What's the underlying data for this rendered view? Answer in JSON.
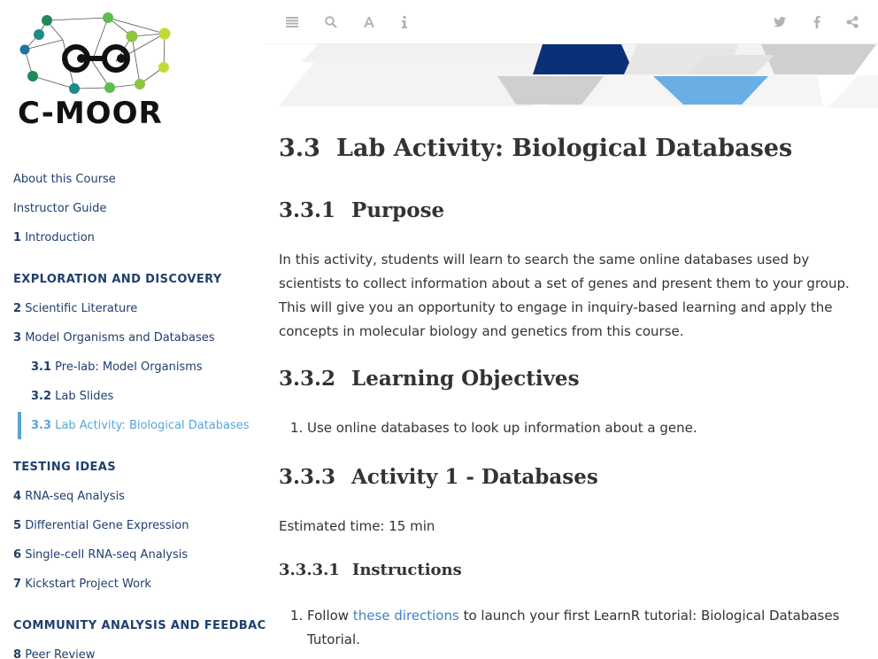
{
  "logo": {
    "text": "C-MOOR"
  },
  "sidebar": {
    "items": [
      {
        "kind": "item",
        "level": 0,
        "num": "",
        "label": "About this Course"
      },
      {
        "kind": "item",
        "level": 0,
        "num": "",
        "label": "Instructor Guide"
      },
      {
        "kind": "item",
        "level": 0,
        "num": "1",
        "label": "Introduction"
      },
      {
        "kind": "part",
        "label": "EXPLORATION AND DISCOVERY"
      },
      {
        "kind": "item",
        "level": 0,
        "num": "2",
        "label": "Scientific Literature"
      },
      {
        "kind": "item",
        "level": 0,
        "num": "3",
        "label": "Model Organisms and Databases"
      },
      {
        "kind": "item",
        "level": 1,
        "num": "3.1",
        "label": "Pre-lab: Model Organisms"
      },
      {
        "kind": "item",
        "level": 1,
        "num": "3.2",
        "label": "Lab Slides"
      },
      {
        "kind": "item",
        "level": 1,
        "num": "3.3",
        "label": "Lab Activity: Biological Databases",
        "active": true
      },
      {
        "kind": "part",
        "label": "TESTING IDEAS"
      },
      {
        "kind": "item",
        "level": 0,
        "num": "4",
        "label": "RNA-seq Analysis"
      },
      {
        "kind": "item",
        "level": 0,
        "num": "5",
        "label": "Differential Gene Expression"
      },
      {
        "kind": "item",
        "level": 0,
        "num": "6",
        "label": "Single-cell RNA-seq Analysis"
      },
      {
        "kind": "item",
        "level": 0,
        "num": "7",
        "label": "Kickstart Project Work"
      },
      {
        "kind": "part",
        "label": "COMMUNITY ANALYSIS AND FEEDBACK"
      },
      {
        "kind": "item",
        "level": 0,
        "num": "8",
        "label": "Peer Review"
      }
    ]
  },
  "toolbar": {
    "left": [
      {
        "icon": "list-icon",
        "name": "toggle-sidebar-button"
      },
      {
        "icon": "search-icon",
        "name": "search-button"
      },
      {
        "icon": "font-icon",
        "name": "font-settings-button"
      },
      {
        "icon": "info-icon",
        "name": "info-button"
      }
    ],
    "right": [
      {
        "icon": "twitter-icon",
        "name": "share-twitter-button"
      },
      {
        "icon": "facebook-icon",
        "name": "share-facebook-button"
      },
      {
        "icon": "share-icon",
        "name": "share-button"
      }
    ]
  },
  "colors": {
    "accent": "#59a5d8",
    "link": "#4183c4",
    "toc": "#1f3f6d",
    "navy": "#0a3178",
    "sky": "#6aaee6",
    "gray": "#cfcfcf"
  },
  "content": {
    "title": {
      "num": "3.3",
      "text": "Lab Activity: Biological Databases"
    },
    "purpose": {
      "num": "3.3.1",
      "heading": "Purpose",
      "body": "In this activity, students will learn to search the same online databases used by scientists to collect information about a set of genes and present them to your group. This will give you an opportunity to engage in inquiry-based learning and apply the concepts in molecular biology and genetics from this course."
    },
    "objectives": {
      "num": "3.3.2",
      "heading": "Learning Objectives",
      "items": [
        "Use online databases to look up information about a gene."
      ]
    },
    "activity": {
      "num": "3.3.3",
      "heading": "Activity 1 - Databases",
      "estimated": "Estimated time: 15 min"
    },
    "instructions": {
      "num": "3.3.3.1",
      "heading": "Instructions",
      "step1_pre": "Follow ",
      "step1_link": "these directions",
      "step1_post": " to launch your first LearnR tutorial: Biological Databases Tutorial."
    }
  }
}
